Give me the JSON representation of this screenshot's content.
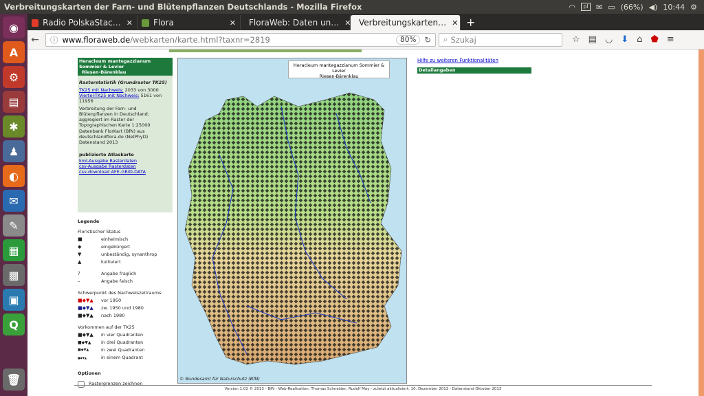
{
  "os": {
    "window_title": "Verbreitungskarten der Farn- und Blütenpflanzen Deutschlands - Mozilla Firefox",
    "battery": "(66%)",
    "clock": "10:44",
    "keyboard": "pl"
  },
  "tabs": [
    {
      "label": "Radio PolskaStac…",
      "color": "#e23b2a"
    },
    {
      "label": "Flora",
      "color": "#6a9a3a"
    },
    {
      "label": "FloraWeb: Daten un…",
      "color": "#7a4aa0"
    },
    {
      "label": "Verbreitungskarten…",
      "color": "#7a4aa0"
    }
  ],
  "nav": {
    "url_domain": "www.floraweb.de",
    "url_path": "/webkarten/karte.html?taxnr=2819",
    "zoom": "80%",
    "search_placeholder": "Szukaj"
  },
  "side": {
    "species": "Heracleum mantegazzianum Sommier & Levier",
    "common": "Riesen-Bärenklau",
    "raster_title": "Rasterstatistik (Grundraster TK25)",
    "tk25_label": "TK25 mit Nachweis:",
    "tk25_value": "2033 von 3000",
    "vtk25_label": "Viertel-TK25 mit Nachweis:",
    "vtk25_value": "5161 von 11956",
    "desc": "Verbreitung der Farn- und Blütenpflanzen in Deutschland; aggregiert im Raster der Topographischen Karte 1:25000",
    "source": "Datenbank FlorKart (BfN) aus deutschlandflora.de (NetPhyD)",
    "date": "Datenstand 2013",
    "atlas_title": "publizierte Atlaskarte",
    "links": [
      "kml-Ausgabe Rasterdaten",
      "csv-Ausgabe Rasterdaten",
      "csv-download AFE-GRID-DATA"
    ]
  },
  "legend": {
    "title": "Legende",
    "status_title": "Floristischer Status",
    "status": [
      {
        "sym": "■",
        "label": "einheimisch"
      },
      {
        "sym": "◆",
        "label": "eingebürgert"
      },
      {
        "sym": "▼",
        "label": "unbeständig, synanthrop"
      },
      {
        "sym": "▲",
        "label": "kultiviert"
      }
    ],
    "extra": [
      {
        "sym": "?",
        "label": "Angabe fraglich"
      },
      {
        "sym": "–",
        "label": "Angabe falsch"
      }
    ],
    "period_title": "Schwerpunkt des Nachweiszeitraums:",
    "periods": [
      {
        "label": "vor 1950",
        "color": "#d00000"
      },
      {
        "label": "zw. 1950 und 1980",
        "color": "#1a1a8a"
      },
      {
        "label": "nach 1980",
        "color": "#000000"
      }
    ],
    "tk_title": "Vorkommen auf der TK25",
    "tk": [
      "in vier Quadranten",
      "in drei Quadranten",
      "in zwei Quadranten",
      "in einem Quadrant"
    ],
    "options_title": "Optionen",
    "checkbox": "Rastergrenzen zeichnen"
  },
  "map": {
    "label": "Heracleum mantegazzianum Sommier & Levier",
    "sub": "Riesen-Bärenklau",
    "copyright": "© Bundesamt für Naturschutz (BfN)"
  },
  "right": {
    "help": "Hilfe zu weiteren Funktionalitäten",
    "detail": "Detailangaben"
  },
  "footer": "Version 1.02 © 2013 - BfN - Web-Realisation: Thomas Schneider, Rudolf May - zuletzt aktualisiert: 10. Dezember 2013 - Datenstand Oktober 2013"
}
